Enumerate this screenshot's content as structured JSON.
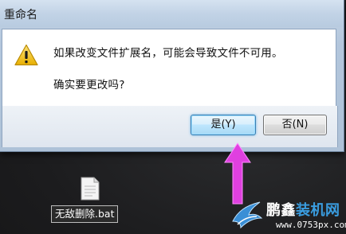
{
  "dialog": {
    "title": "重命名",
    "message": "如果改变文件扩展名，可能会导致文件不可用。",
    "question": "确实要更改吗?",
    "yes_label": "是(Y)",
    "no_label": "否(N)"
  },
  "desktop": {
    "file_name": "无敌删除.bat"
  },
  "annotation": {
    "arrow_color": "#e040e0",
    "points_to": "yes-button"
  },
  "watermark": {
    "brand_part1": "鹏鑫",
    "brand_part2": "装机网",
    "url": "www.0753px.com"
  },
  "colors": {
    "yes_button_border": "#3c7fb1",
    "titlebar": "#c2d3e6",
    "warning_icon": "#f2c318"
  },
  "icons": [
    "warning-icon",
    "file-icon",
    "arrow-icon",
    "bird-logo-icon"
  ]
}
